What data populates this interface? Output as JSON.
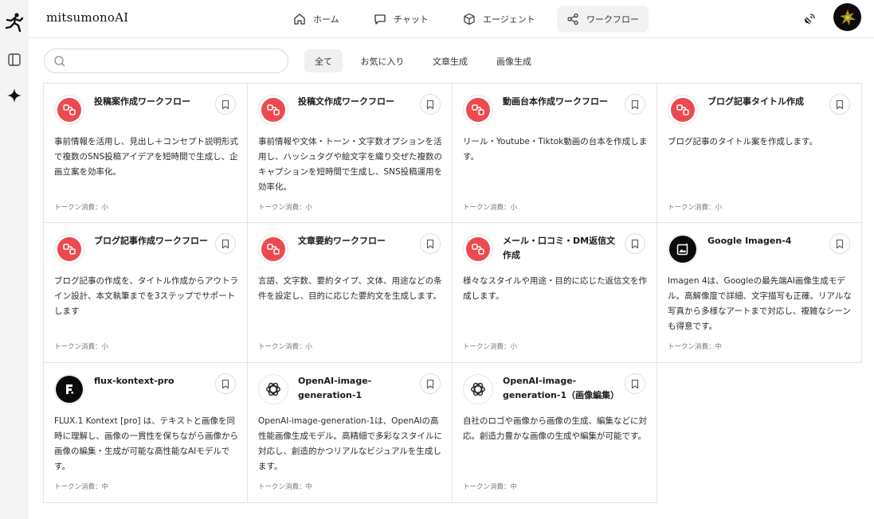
{
  "app": {
    "title": "mitsumonoAI"
  },
  "header": {
    "nav": [
      {
        "label": "ホーム",
        "icon": "home-icon"
      },
      {
        "label": "チャット",
        "icon": "chat-icon"
      },
      {
        "label": "エージェント",
        "icon": "cube-icon"
      },
      {
        "label": "ワークフロー",
        "icon": "share-icon",
        "active": true
      }
    ]
  },
  "search": {
    "value": "",
    "placeholder": ""
  },
  "tabs": [
    {
      "label": "全て",
      "active": true
    },
    {
      "label": "お気に入り"
    },
    {
      "label": "文章生成"
    },
    {
      "label": "画像生成"
    }
  ],
  "colors": {
    "accent_red": "#ec4a4f",
    "rail_bg": "#f4f4f5",
    "active_bg": "#f2f2f3"
  },
  "cards": [
    {
      "title": "投稿案作成ワークフロー",
      "desc": "事前情報を活用し、見出し＋コンセプト説明形式で複数のSNS投稿アイデアを短時間で生成し、企画立案を効率化。",
      "tokens": "トークン消費：小",
      "icon": "workflow-icon"
    },
    {
      "title": "投稿文作成ワークフロー",
      "desc": "事前情報や文体・トーン・文字数オプションを活用し、ハッシュタグや絵文字を織り交ぜた複数のキャプションを短時間で生成し、SNS投稿運用を効率化。",
      "tokens": "トークン消費：小",
      "icon": "workflow-icon"
    },
    {
      "title": "動画台本作成ワークフロー",
      "desc": "リール・Youtube・Tiktok動画の台本を作成します。",
      "tokens": "トークン消費：小",
      "icon": "workflow-icon"
    },
    {
      "title": "ブログ記事タイトル作成",
      "desc": "ブログ記事のタイトル案を作成します。",
      "tokens": "トークン消費：小",
      "icon": "workflow-icon"
    },
    {
      "title": "ブログ記事作成ワークフロー",
      "desc": "ブログ記事の作成を、タイトル作成からアウトライン設計、本文執筆までを3ステップでサポートします",
      "tokens": "トークン消費：小",
      "icon": "workflow-icon"
    },
    {
      "title": "文章要約ワークフロー",
      "desc": "言語、文字数、要約タイプ、文体、用途などの条件を設定し、目的に応じた要約文を生成します。",
      "tokens": "トークン消費：小",
      "icon": "workflow-icon"
    },
    {
      "title": "メール・口コミ・DM返信文作成",
      "desc": "様々なスタイルや用途・目的に応じた返信文を作成します。",
      "tokens": "トークン消費：小",
      "icon": "workflow-icon"
    },
    {
      "title": "Google Imagen-4",
      "desc": "Imagen 4は、Googleの最先端AI画像生成モデル。高解像度で詳細、文字描写も正確。リアルな写真から多様なアートまで対応し、複雑なシーンも得意です。",
      "tokens": "トークン消費：中",
      "icon": "image-ai-icon"
    },
    {
      "title": "flux-kontext-pro",
      "desc": "FLUX.1 Kontext [pro] は、テキストと画像を同時に理解し、画像の一貫性を保ちながら画像から画像の編集・生成が可能な高性能なAIモデルです。",
      "tokens": "トークン消費：中",
      "icon": "flux-icon"
    },
    {
      "title": "OpenAI-image-generation-1",
      "desc": "OpenAI-image-generation-1は、OpenAIの高性能画像生成モデル。高精細で多彩なスタイルに対応し、創造的かつリアルなビジュアルを生成します。",
      "tokens": "トークン消費：中",
      "icon": "openai-icon"
    },
    {
      "title": "OpenAI-image-generation-1（画像編集）",
      "desc": "自社のロゴや画像から画像の生成、編集などに対応。創造力豊かな画像の生成や編集が可能です。",
      "tokens": "トークン消費：中",
      "icon": "openai-icon"
    }
  ]
}
